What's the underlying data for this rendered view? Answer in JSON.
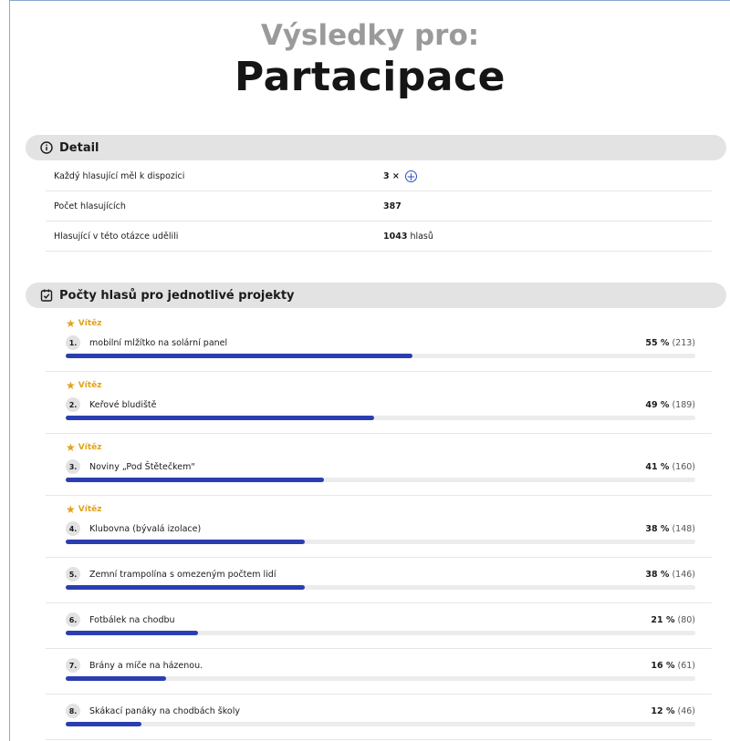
{
  "header": {
    "subtitle": "Výsledky pro:",
    "title": "Partacipace"
  },
  "detail": {
    "heading": "Detail",
    "icon": "info-circle-icon",
    "rows": [
      {
        "label": "Každý hlasující měl k dispozici",
        "value": "3 ×",
        "icon": "plus-circle-icon"
      },
      {
        "label": "Počet hlasujících",
        "value": "387"
      },
      {
        "label": "Hlasující v této otázce udělili",
        "value": "1043",
        "suffix": "hlasů"
      }
    ]
  },
  "projects_section": {
    "heading": "Počty hlasů pro jednotlivé projekty",
    "icon": "checkbox-icon",
    "winner_label": "Vítěz",
    "accent": "#2a3eb1",
    "winner_color": "#e3a21a",
    "projects": [
      {
        "rank": "1.",
        "name": "mobilní mlžítko na solární panel",
        "percent": "55 %",
        "votes": "(213)",
        "share": 0.55,
        "winner": true
      },
      {
        "rank": "2.",
        "name": "Keřové bludiště",
        "percent": "49 %",
        "votes": "(189)",
        "share": 0.49,
        "winner": true
      },
      {
        "rank": "3.",
        "name": "Noviny „Pod Štětečkem\"",
        "percent": "41 %",
        "votes": "(160)",
        "share": 0.41,
        "winner": true
      },
      {
        "rank": "4.",
        "name": "Klubovna (bývalá izolace)",
        "percent": "38 %",
        "votes": "(148)",
        "share": 0.38,
        "winner": true
      },
      {
        "rank": "5.",
        "name": "Zemní trampolína s omezeným počtem lidí",
        "percent": "38 %",
        "votes": "(146)",
        "share": 0.38,
        "winner": false
      },
      {
        "rank": "6.",
        "name": "Fotbálek na chodbu",
        "percent": "21 %",
        "votes": "(80)",
        "share": 0.21,
        "winner": false
      },
      {
        "rank": "7.",
        "name": "Brány a míče na házenou.",
        "percent": "16 %",
        "votes": "(61)",
        "share": 0.16,
        "winner": false
      },
      {
        "rank": "8.",
        "name": "Skákací panáky na chodbách školy",
        "percent": "12 %",
        "votes": "(46)",
        "share": 0.12,
        "winner": false
      }
    ]
  }
}
